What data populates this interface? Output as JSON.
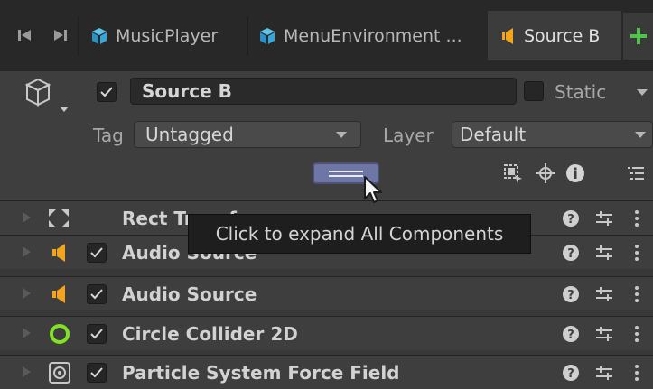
{
  "tabs": [
    {
      "label": "MusicPlayer",
      "icon": "gameobject-icon"
    },
    {
      "label": "MenuEnvironment ...",
      "icon": "gameobject-icon"
    },
    {
      "label": "Source B",
      "icon": "audio-source-icon",
      "active": true
    }
  ],
  "header": {
    "name": "Source B",
    "active": true,
    "static_label": "Static",
    "static": false,
    "tag_label": "Tag",
    "tag_value": "Untagged",
    "layer_label": "Layer",
    "layer_value": "Default"
  },
  "components": [
    {
      "label": "Rect Transform",
      "icon": "rect-transform-icon",
      "has_checkbox": false
    },
    {
      "label": "Audio Source",
      "icon": "audio-source-icon",
      "has_checkbox": true,
      "enabled": true
    },
    {
      "label": "Audio Source",
      "icon": "audio-source-icon",
      "has_checkbox": true,
      "enabled": true
    },
    {
      "label": "Circle Collider 2D",
      "icon": "circle-collider-icon",
      "has_checkbox": true,
      "enabled": true
    },
    {
      "label": "Particle System Force Field",
      "icon": "force-field-icon",
      "has_checkbox": true,
      "enabled": true
    }
  ],
  "tooltip": "Click to expand All Components",
  "colors": {
    "accent_add": "#4fc24a",
    "audio_icon": "#f2a51c",
    "collider_icon": "#7fe321",
    "expand_button": "#6e76a6"
  }
}
